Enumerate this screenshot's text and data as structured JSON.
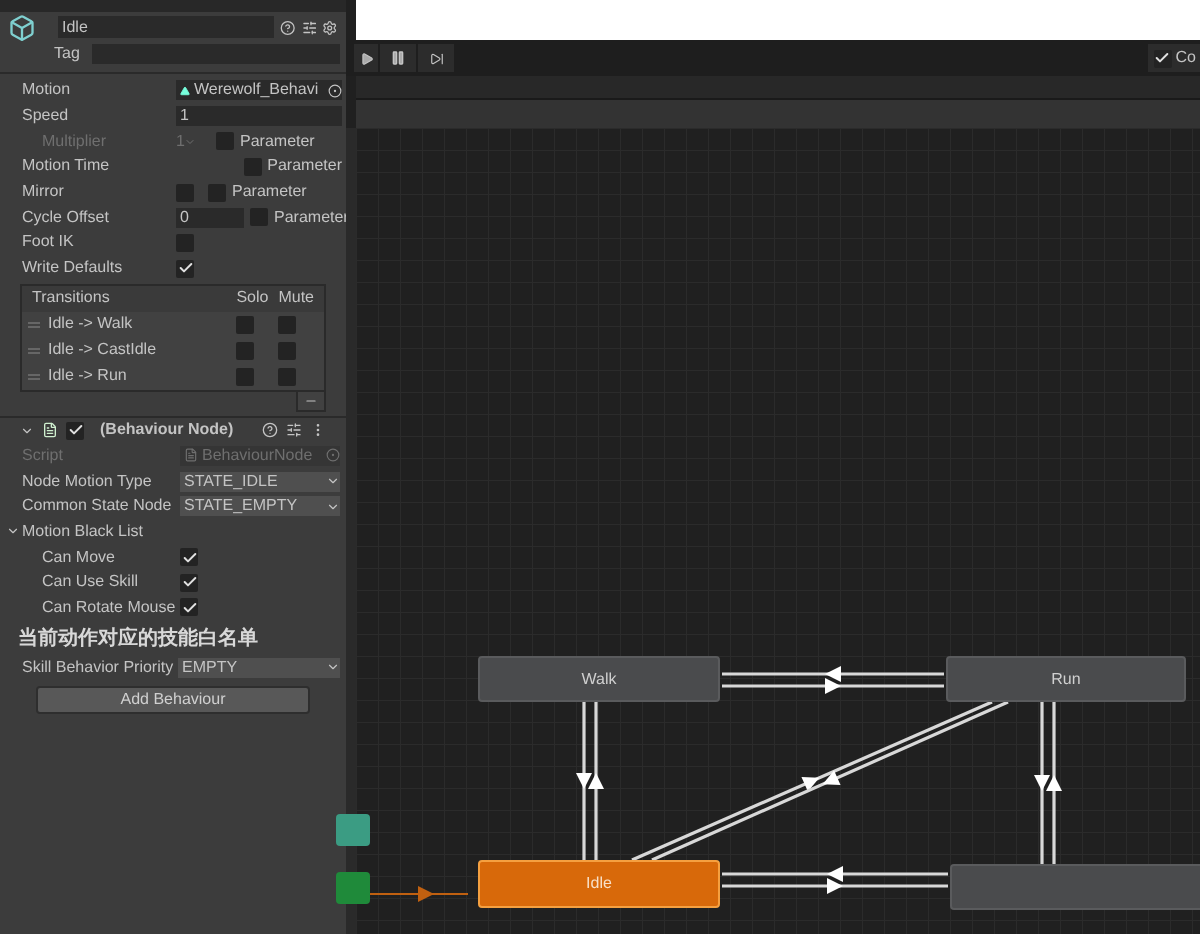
{
  "inspector": {
    "name": "Idle",
    "tag_label": "Tag",
    "properties": [
      {
        "kind": "object",
        "label": "Motion",
        "value": "Werewolf_Behavi",
        "disabled": false
      },
      {
        "kind": "text",
        "label": "Speed",
        "value": "1",
        "disabled": false
      },
      {
        "kind": "dropdown_param",
        "label": "Multiplier",
        "value": "1",
        "param_checked": false,
        "param_label": "Parameter",
        "disabled": true
      },
      {
        "kind": "param",
        "label": "Motion Time",
        "param_checked": false,
        "param_label": "Parameter",
        "disabled": false
      },
      {
        "kind": "toggle_param",
        "label": "Mirror",
        "checked": false,
        "param_checked": false,
        "param_label": "Parameter",
        "disabled": false
      },
      {
        "kind": "text_param",
        "label": "Cycle Offset",
        "value": "0",
        "param_checked": false,
        "param_label": "Parameter",
        "disabled": false
      },
      {
        "kind": "toggle",
        "label": "Foot IK",
        "checked": false,
        "disabled": false
      },
      {
        "kind": "toggle",
        "label": "Write Defaults",
        "checked": true,
        "disabled": false
      }
    ],
    "transitions": {
      "header": "Transitions",
      "solo_label": "Solo",
      "mute_label": "Mute",
      "rows": [
        {
          "label": "Idle -> Walk",
          "solo": false,
          "mute": false
        },
        {
          "label": "Idle -> CastIdle",
          "solo": false,
          "mute": false
        },
        {
          "label": "Idle -> Run",
          "solo": false,
          "mute": false
        }
      ]
    },
    "component": {
      "title": "(Behaviour Node)",
      "enabled": true,
      "expanded": true,
      "fields": [
        {
          "kind": "object",
          "label": "Script",
          "value": "BehaviourNode",
          "disabled": true
        },
        {
          "kind": "dropdown",
          "label": "Node Motion Type",
          "value": "STATE_IDLE",
          "disabled": false
        },
        {
          "kind": "dropdown",
          "label": "Common State Node",
          "value": "STATE_EMPTY",
          "disabled": false
        }
      ],
      "black_list": {
        "label": "Motion Black List",
        "expanded": true,
        "items": [
          {
            "label": "Can Move",
            "checked": true
          },
          {
            "label": "Can Use Skill",
            "checked": true
          },
          {
            "label": "Can Rotate Mouse",
            "checked": true
          }
        ]
      },
      "section_heading": "当前动作对应的技能白名单",
      "priority": {
        "label": "Skill Behavior Priority",
        "value": "EMPTY"
      }
    },
    "add_button": "Add Behaviour"
  },
  "toolbar": {
    "toggle": {
      "label": "Co",
      "checked": true
    }
  },
  "graph": {
    "nodes": [
      {
        "kind": "state",
        "label": "Walk"
      },
      {
        "kind": "state",
        "label": "Run"
      },
      {
        "kind": "default",
        "label": "Idle"
      },
      {
        "kind": "state"
      },
      {
        "kind": "any"
      },
      {
        "kind": "entry"
      }
    ]
  }
}
